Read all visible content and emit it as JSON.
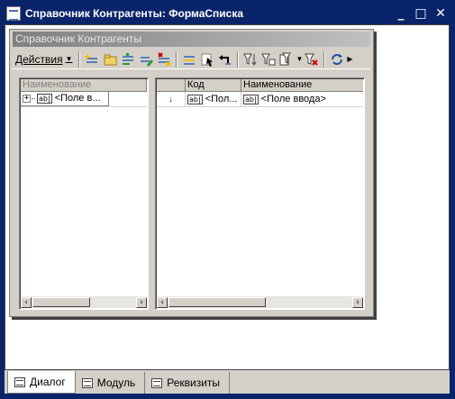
{
  "window": {
    "title": "Справочник Контрагенты: ФормаСписка",
    "buttons": [
      "_",
      "□",
      "✕"
    ]
  },
  "form": {
    "title": "Справочник Контрагенты",
    "toolbar": {
      "actions_label": "Действия",
      "icons": [
        "add-icon",
        "add-folder-icon",
        "copy-icon",
        "edit-icon",
        "delete-icon",
        "level-icon",
        "select-icon",
        "back-icon",
        "filter-icon",
        "filter-value-icon",
        "filter-history-icon",
        "clear-filter-icon",
        "refresh-icon"
      ]
    },
    "left_grid": {
      "header": "Наименование",
      "row_text": "<Поле в..."
    },
    "right_grid": {
      "headers": [
        "",
        "Код",
        "Наименование"
      ],
      "row_marker": "↓",
      "row_code": "<Пол...",
      "row_name": "<Поле ввода>"
    }
  },
  "tabs": [
    {
      "label": "Диалог",
      "active": true
    },
    {
      "label": "Модуль",
      "active": false
    },
    {
      "label": "Реквизиты",
      "active": false
    }
  ],
  "ab_label": "ab|"
}
